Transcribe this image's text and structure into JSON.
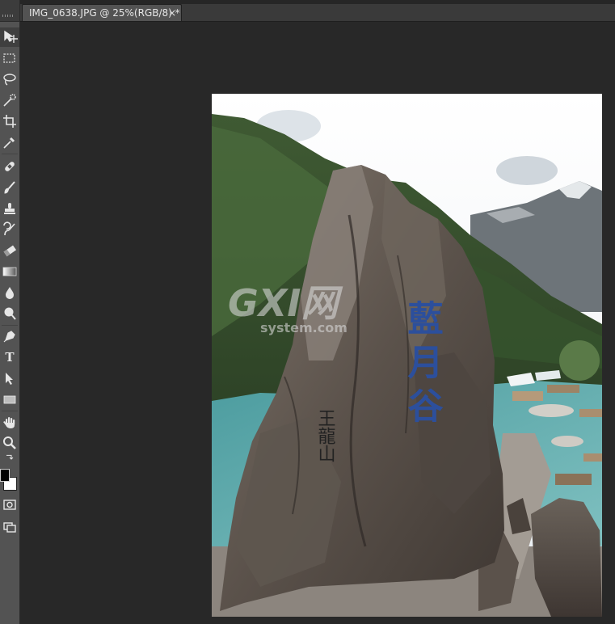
{
  "document": {
    "tab_title": "IMG_0638.JPG @ 25%(RGB/8) *",
    "close_glyph": "×"
  },
  "tools": [
    {
      "name": "move-tool"
    },
    {
      "name": "rectangular-marquee-tool"
    },
    {
      "name": "lasso-tool"
    },
    {
      "name": "quick-selection-tool"
    },
    {
      "name": "crop-tool"
    },
    {
      "name": "eyedropper-tool"
    },
    {
      "name": "spot-healing-brush-tool"
    },
    {
      "name": "brush-tool"
    },
    {
      "name": "clone-stamp-tool"
    },
    {
      "name": "history-brush-tool"
    },
    {
      "name": "eraser-tool"
    },
    {
      "name": "gradient-tool"
    },
    {
      "name": "blur-tool"
    },
    {
      "name": "dodge-tool"
    },
    {
      "name": "pen-tool"
    },
    {
      "name": "type-tool",
      "glyph": "T"
    },
    {
      "name": "path-selection-tool"
    },
    {
      "name": "rectangle-tool"
    },
    {
      "name": "hand-tool"
    },
    {
      "name": "zoom-tool"
    }
  ],
  "colors": {
    "foreground": "#000000",
    "background": "#ffffff",
    "panel": "#535353",
    "workspace": "#282828"
  },
  "image": {
    "watermark_main": "GXI网",
    "watermark_sub": "system.com",
    "carving_main": "藍月谷",
    "carving_side": "王龍山"
  }
}
